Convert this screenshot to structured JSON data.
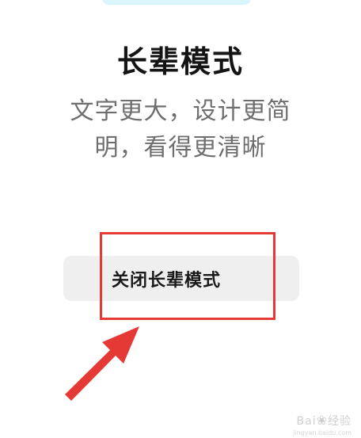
{
  "title": "长辈模式",
  "description_line1": "文字更大，设计更简",
  "description_line2": "明，看得更清晰",
  "close_button_label": "关闭长辈模式",
  "accent_color": "#e53935",
  "watermark": {
    "brand": "Bai",
    "brand_suffix": "经验",
    "url": "jingyan.baidu.com"
  }
}
